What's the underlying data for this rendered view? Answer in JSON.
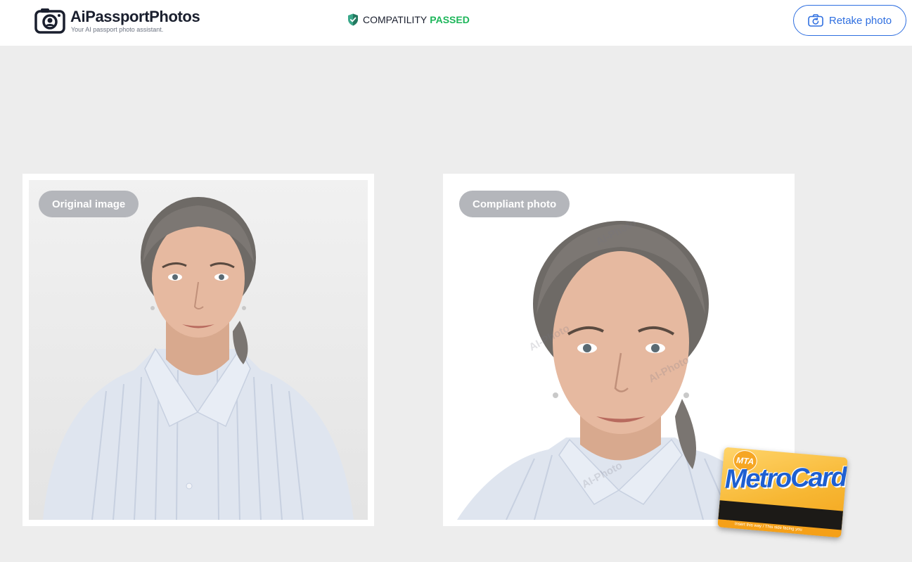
{
  "header": {
    "brand": {
      "title": "AiPassportPhotos",
      "subtitle": "Your AI passport photo assistant.",
      "icon": "camera-logo-icon"
    },
    "compatibility": {
      "label": "COMPATILITY",
      "status": "PASSED",
      "status_color": "#1db65a",
      "icon": "shield-check-icon"
    },
    "retake_button": {
      "label": "Retake photo",
      "icon": "camera-retake-icon",
      "color": "#2f6fe0"
    }
  },
  "main": {
    "original": {
      "badge": "Original image"
    },
    "compliant": {
      "badge": "Compliant photo",
      "watermark": "AI-Photo"
    },
    "sticker": {
      "logo": "MTA",
      "name": "MetroCard",
      "footer": "Insert this way / This side facing you"
    }
  }
}
